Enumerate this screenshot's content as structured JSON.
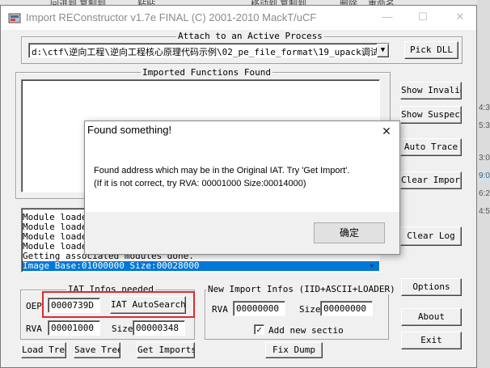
{
  "background": {
    "top_items": [
      "回进到 复制到",
      "粘贴",
      "移动到 复制到",
      "删除",
      "重命名"
    ],
    "right_items": [
      "4:3",
      "5:3",
      "3:0",
      "9:0",
      "6:2",
      "4:5"
    ]
  },
  "window": {
    "title": "Import REConstructor v1.7e FINAL (C) 2001-2010 MackT/uCF",
    "controls": {
      "minimize": "—",
      "maximize": "☐",
      "close": "✕"
    }
  },
  "attach": {
    "group_label": "Attach to an Active Process",
    "process_value": "d:\\ctf\\逆向工程\\逆向工程核心原理代码示例\\02_pe_file_format\\19_upack调试",
    "pick_dll": "Pick DLL"
  },
  "imported": {
    "group_label": "Imported Functions Found"
  },
  "side_buttons": {
    "show_invalid": "Show Invalid",
    "show_suspect": "Show Suspect",
    "auto_trace": "Auto Trace",
    "clear_imports": "Clear Imports",
    "clear_log": "Clear Log"
  },
  "log": {
    "lines": [
      "Module loaded",
      "Module loaded",
      "Module loaded",
      "Module loaded",
      "Getting associated modules done.",
      "Image Base:01000000 Size:00028000"
    ]
  },
  "iat": {
    "group_label": "IAT Infos needed",
    "oep_label": "OEP",
    "oep_value": "0000739D",
    "autosearch": "IAT AutoSearch",
    "rva_label": "RVA",
    "rva_value": "00001000",
    "size_label": "Size",
    "size_value": "00000348"
  },
  "new_import": {
    "group_label": "New Import Infos (IID+ASCII+LOADER)",
    "rva_label": "RVA",
    "rva_value": "00000000",
    "size_label": "Size",
    "size_value": "00000000",
    "add_section_label": "Add new sectio",
    "add_section_checked": true
  },
  "right_buttons": {
    "options": "Options",
    "about": "About",
    "exit": "Exit"
  },
  "bottom_buttons": {
    "load_tree": "Load Tree",
    "save_tree": "Save Tree",
    "get_imports": "Get Imports",
    "fix_dump": "Fix Dump"
  },
  "dialog": {
    "title": "Found something!",
    "message_line1": "Found address which may be in the Original IAT. Try 'Get Import'.",
    "message_line2": "(If it is not correct, try RVA: 00001000 Size:00014000)",
    "ok": "确定",
    "close": "✕"
  },
  "colors": {
    "highlight_box": "#e0282e",
    "selection": "#0078d7"
  }
}
